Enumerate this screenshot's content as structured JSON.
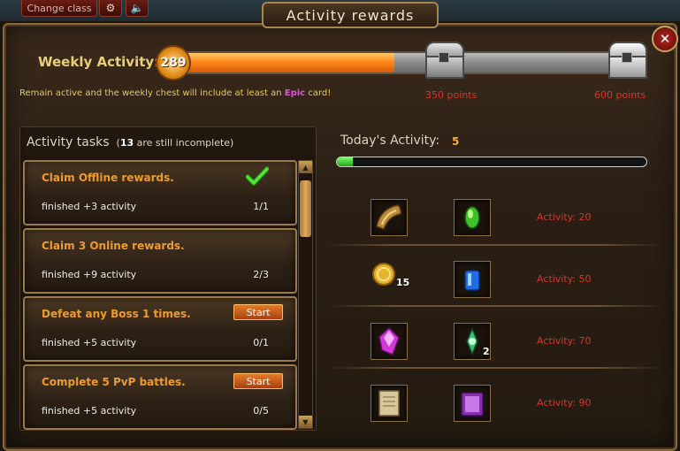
{
  "top": {
    "change_class": "Change class",
    "gear_glyph": "⚙",
    "sound_glyph": "🔈"
  },
  "window": {
    "title": "Activity rewards",
    "close_glyph": "✕"
  },
  "weekly": {
    "label": "Weekly Activity:",
    "value": "289",
    "progress_fraction": 0.48,
    "notice_before": "Remain active and the weekly chest will include at least an ",
    "notice_epic": "Epic",
    "notice_after": " card!",
    "chests": [
      {
        "points_label": "350 points"
      },
      {
        "points_label": "600 points"
      }
    ]
  },
  "tasks": {
    "header": "Activity tasks",
    "incomplete_count": "13",
    "incomplete_suffix": "are still incomplete",
    "paren_open": "(",
    "paren_close": ")",
    "start_label": "Start",
    "items": [
      {
        "title": "Claim Offline rewards.",
        "reward": "finished +3 activity",
        "progress": "1/1",
        "state": "done"
      },
      {
        "title": "Claim 3 Online rewards.",
        "reward": "finished +9 activity",
        "progress": "2/3",
        "state": "none"
      },
      {
        "title": "Defeat any Boss 1 times.",
        "reward": "finished +5 activity",
        "progress": "0/1",
        "state": "start"
      },
      {
        "title": "Complete 5 PvP battles.",
        "reward": "finished +5 activity",
        "progress": "0/5",
        "state": "start"
      }
    ],
    "scroll_up_glyph": "▲",
    "scroll_down_glyph": "▼"
  },
  "today": {
    "label": "Today's Activity:",
    "value": "5",
    "progress_fraction": 0.05,
    "rows": [
      {
        "item1_icon": "horn-icon",
        "item2_icon": "green-gem-icon",
        "item2_count": "",
        "item1_count": "",
        "activity": "Activity: 20"
      },
      {
        "item1_icon": "gold-coin-icon",
        "item1_count": "15",
        "item2_icon": "blue-potion-icon",
        "item2_count": "",
        "activity": "Activity: 50"
      },
      {
        "item1_icon": "pink-crystal-icon",
        "item1_count": "",
        "item2_icon": "green-shard-icon",
        "item2_count": "2",
        "activity": "Activity: 70"
      },
      {
        "item1_icon": "scroll-icon",
        "item1_count": "",
        "item2_icon": "purple-book-icon",
        "item2_count": "",
        "activity": "Activity: 90"
      }
    ]
  },
  "colors": {
    "accent_orange": "#ef9b2a",
    "points_red": "#d8362c",
    "epic_pink": "#e24ce0"
  }
}
